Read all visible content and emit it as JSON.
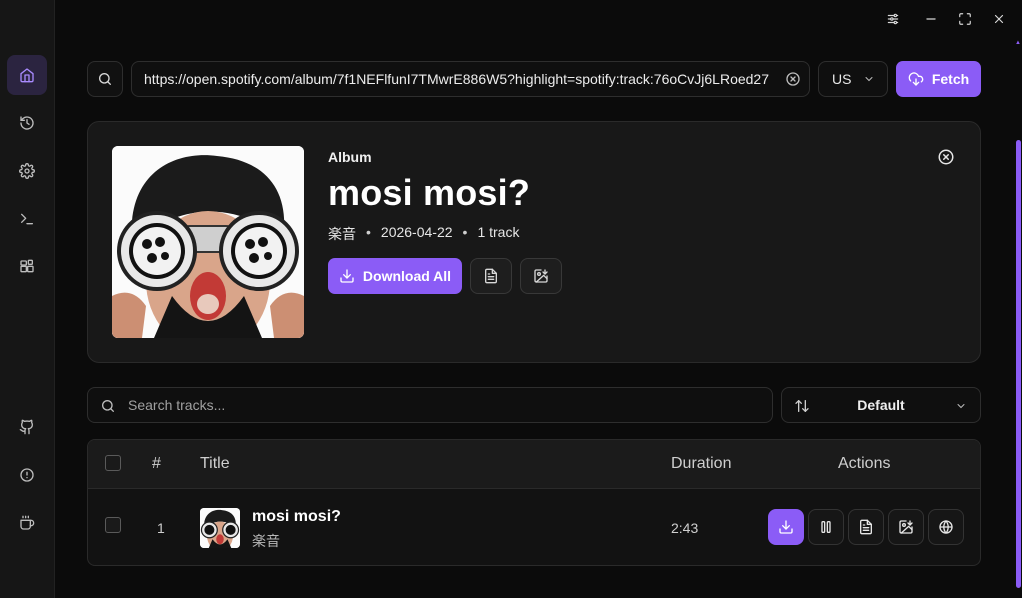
{
  "window_controls": {
    "settings_icon": "sliders-icon",
    "minimize_icon": "minimize-icon",
    "maximize_icon": "maximize-icon",
    "close_icon": "close-icon"
  },
  "sidebar": {
    "items": [
      {
        "icon": "home-icon",
        "active": true
      },
      {
        "icon": "history-icon",
        "active": false
      },
      {
        "icon": "settings-icon",
        "active": false
      },
      {
        "icon": "terminal-icon",
        "active": false
      },
      {
        "icon": "apps-icon",
        "active": false
      }
    ],
    "bottom": [
      {
        "icon": "github-icon"
      },
      {
        "icon": "info-icon"
      },
      {
        "icon": "coffee-icon"
      }
    ]
  },
  "toolbar": {
    "url_value": "https://open.spotify.com/album/7f1NEFlfunI7TMwrE886W5?highlight=spotify:track:76oCvJj6LRoed27",
    "region_value": "US",
    "fetch_label": "Fetch"
  },
  "album": {
    "type_label": "Album",
    "title": "mosi mosi?",
    "artist": "楽音",
    "date": "2026-04-22",
    "track_count": "1 track",
    "separator": "•",
    "download_all_label": "Download All"
  },
  "tracks_controls": {
    "search_placeholder": "Search tracks...",
    "sort_value": "Default"
  },
  "table": {
    "headers": {
      "num": "#",
      "title": "Title",
      "duration": "Duration",
      "actions": "Actions"
    },
    "rows": [
      {
        "num": "1",
        "title": "mosi mosi?",
        "artist": "楽音",
        "duration": "2:43"
      }
    ]
  },
  "colors": {
    "accent": "#8b5cf6",
    "background": "#0b0b0b",
    "card": "#181818"
  }
}
